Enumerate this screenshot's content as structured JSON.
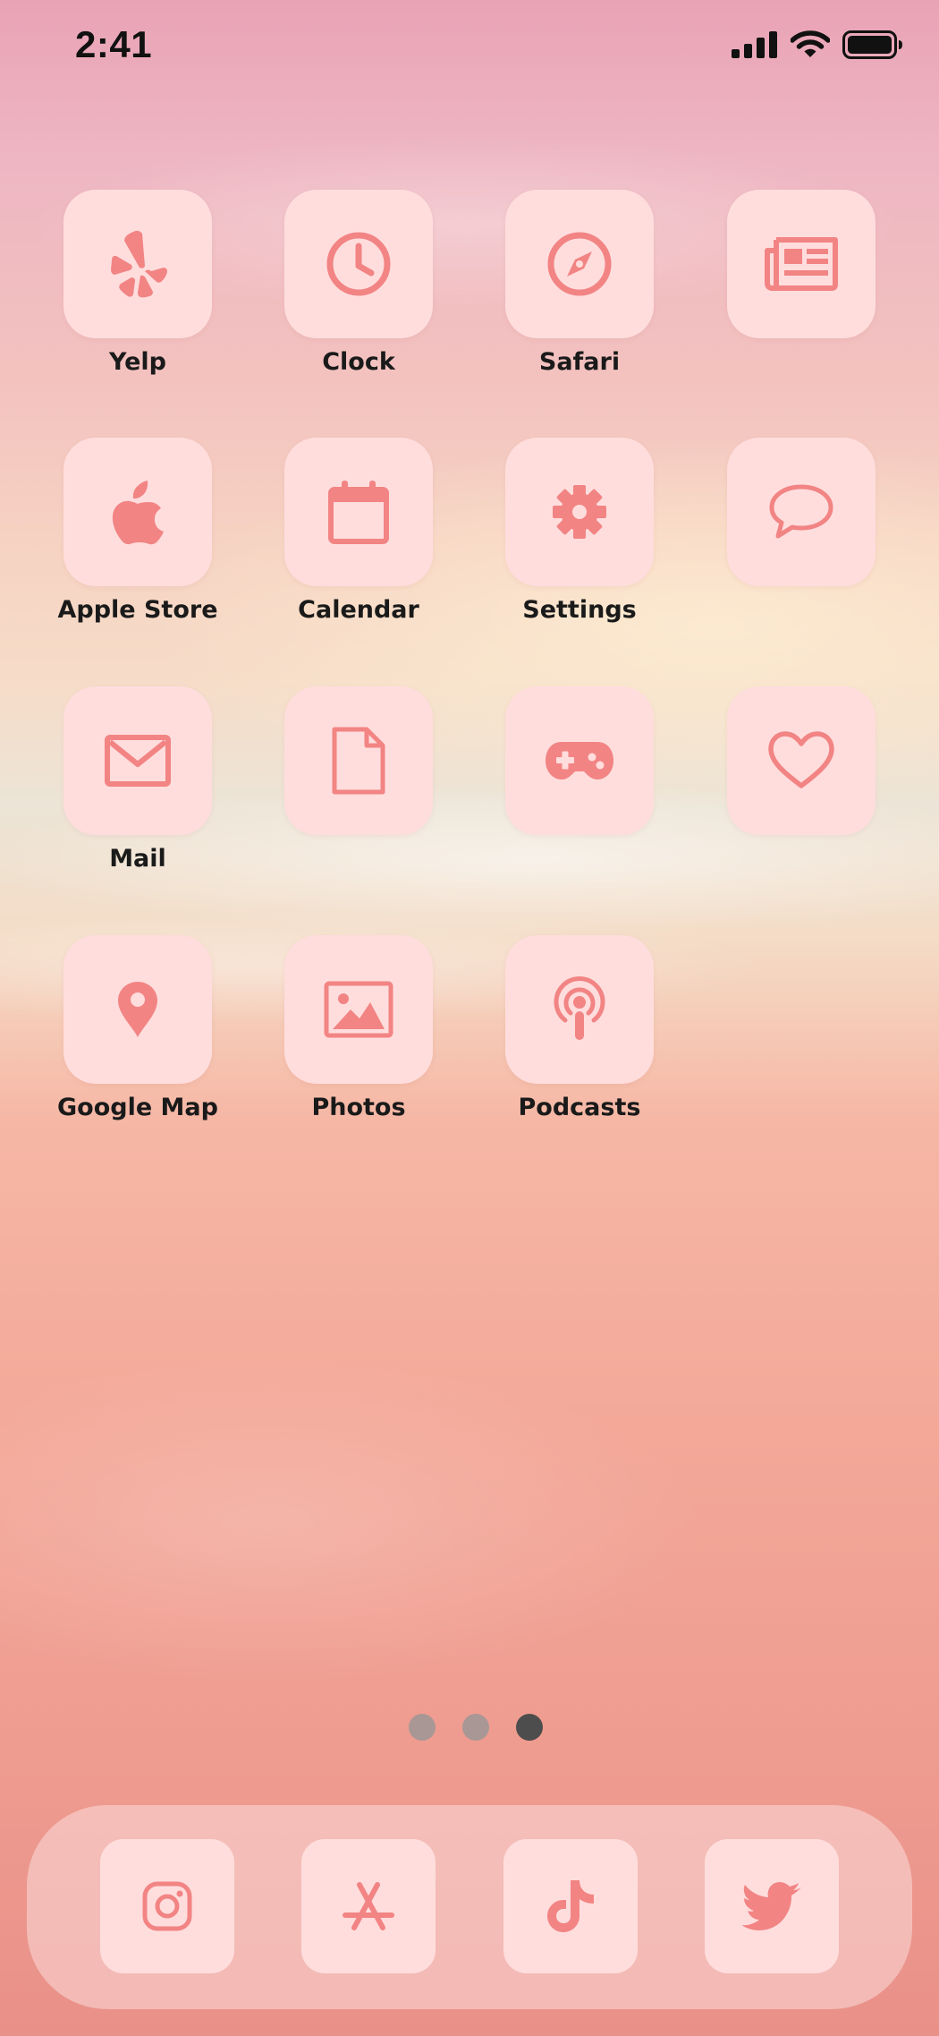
{
  "status_bar": {
    "time": "2:41"
  },
  "theme": {
    "icon_color": "#f28484",
    "tile_color": "#ffdddd",
    "label_color": "#1a1a1a"
  },
  "apps": [
    {
      "label": "Yelp",
      "icon": "yelp-icon"
    },
    {
      "label": "Clock",
      "icon": "clock-icon"
    },
    {
      "label": "Safari",
      "icon": "compass-icon"
    },
    {
      "label": "",
      "icon": "newspaper-icon"
    },
    {
      "label": "Apple Store",
      "icon": "apple-icon"
    },
    {
      "label": "Calendar",
      "icon": "calendar-icon"
    },
    {
      "label": "Settings",
      "icon": "gear-icon"
    },
    {
      "label": "",
      "icon": "speech-bubble-icon"
    },
    {
      "label": "Mail",
      "icon": "envelope-icon"
    },
    {
      "label": "",
      "icon": "document-icon"
    },
    {
      "label": "",
      "icon": "gamepad-icon"
    },
    {
      "label": "",
      "icon": "heart-icon"
    },
    {
      "label": "Google Map",
      "icon": "map-pin-icon"
    },
    {
      "label": "Photos",
      "icon": "photo-icon"
    },
    {
      "label": "Podcasts",
      "icon": "podcast-icon"
    }
  ],
  "page_indicator": {
    "total": 3,
    "current": 3
  },
  "dock": [
    {
      "icon": "instagram-icon"
    },
    {
      "icon": "app-store-icon"
    },
    {
      "icon": "tiktok-icon"
    },
    {
      "icon": "twitter-icon"
    }
  ]
}
